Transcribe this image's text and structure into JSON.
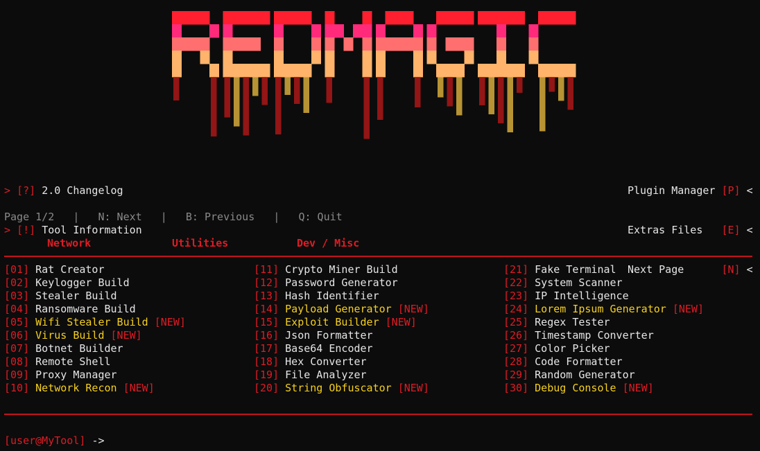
{
  "banner": {
    "text": "RED MAGIC",
    "colors": [
      "#ff1f2e",
      "#ff2a7a",
      "#ff6f6f",
      "#ffb36b",
      "#f0c040",
      "#c01818"
    ]
  },
  "top_left": [
    {
      "prompt": ">",
      "key": "[?]",
      "label": "2.0 Changelog"
    },
    {
      "prompt": ">",
      "key": "[!]",
      "label": "Tool Information"
    }
  ],
  "top_right": [
    {
      "label": "Plugin Manager",
      "key": "[P]",
      "prompt": "<"
    },
    {
      "label": "Extras Files",
      "key": "[E]",
      "prompt": "<"
    },
    {
      "label": "Next Page",
      "key": "[N]",
      "prompt": "<"
    }
  ],
  "nav": {
    "page": "Page 1/2",
    "sep": "|",
    "next": "N: Next",
    "prev": "B: Previous",
    "quit": "Q: Quit"
  },
  "categories": [
    "Network",
    "Utilities",
    "Dev / Misc"
  ],
  "new_tag": "[NEW]",
  "columns": [
    [
      {
        "num": "[01]",
        "label": "Rat Creator",
        "new": false
      },
      {
        "num": "[02]",
        "label": "Keylogger Build",
        "new": false
      },
      {
        "num": "[03]",
        "label": "Stealer Build",
        "new": false
      },
      {
        "num": "[04]",
        "label": "Ransomware Build",
        "new": false
      },
      {
        "num": "[05]",
        "label": "Wifi Stealer Build",
        "new": true
      },
      {
        "num": "[06]",
        "label": "Virus Build",
        "new": true
      },
      {
        "num": "[07]",
        "label": "Botnet Builder",
        "new": false
      },
      {
        "num": "[08]",
        "label": "Remote Shell",
        "new": false
      },
      {
        "num": "[09]",
        "label": "Proxy Manager",
        "new": false
      },
      {
        "num": "[10]",
        "label": "Network Recon",
        "new": true
      }
    ],
    [
      {
        "num": "[11]",
        "label": "Crypto Miner Build",
        "new": false
      },
      {
        "num": "[12]",
        "label": "Password Generator",
        "new": false
      },
      {
        "num": "[13]",
        "label": "Hash Identifier",
        "new": false
      },
      {
        "num": "[14]",
        "label": "Payload Generator",
        "new": true
      },
      {
        "num": "[15]",
        "label": "Exploit Builder",
        "new": true
      },
      {
        "num": "[16]",
        "label": "Json Formatter",
        "new": false
      },
      {
        "num": "[17]",
        "label": "Base64 Encoder",
        "new": false
      },
      {
        "num": "[18]",
        "label": "Hex Converter",
        "new": false
      },
      {
        "num": "[19]",
        "label": "File Analyzer",
        "new": false
      },
      {
        "num": "[20]",
        "label": "String Obfuscator",
        "new": true
      }
    ],
    [
      {
        "num": "[21]",
        "label": "Fake Terminal",
        "new": false
      },
      {
        "num": "[22]",
        "label": "System Scanner",
        "new": false
      },
      {
        "num": "[23]",
        "label": "IP Intelligence",
        "new": false
      },
      {
        "num": "[24]",
        "label": "Lorem Ipsum Generator",
        "new": true
      },
      {
        "num": "[25]",
        "label": "Regex Tester",
        "new": false
      },
      {
        "num": "[26]",
        "label": "Timestamp Converter",
        "new": false
      },
      {
        "num": "[27]",
        "label": "Color Picker",
        "new": false
      },
      {
        "num": "[28]",
        "label": "Code Formatter",
        "new": false
      },
      {
        "num": "[29]",
        "label": "Random Generator",
        "new": false
      },
      {
        "num": "[30]",
        "label": "Debug Console",
        "new": true
      }
    ]
  ],
  "prompt": {
    "user": "[user@MyTool]",
    "arrow": "->"
  }
}
